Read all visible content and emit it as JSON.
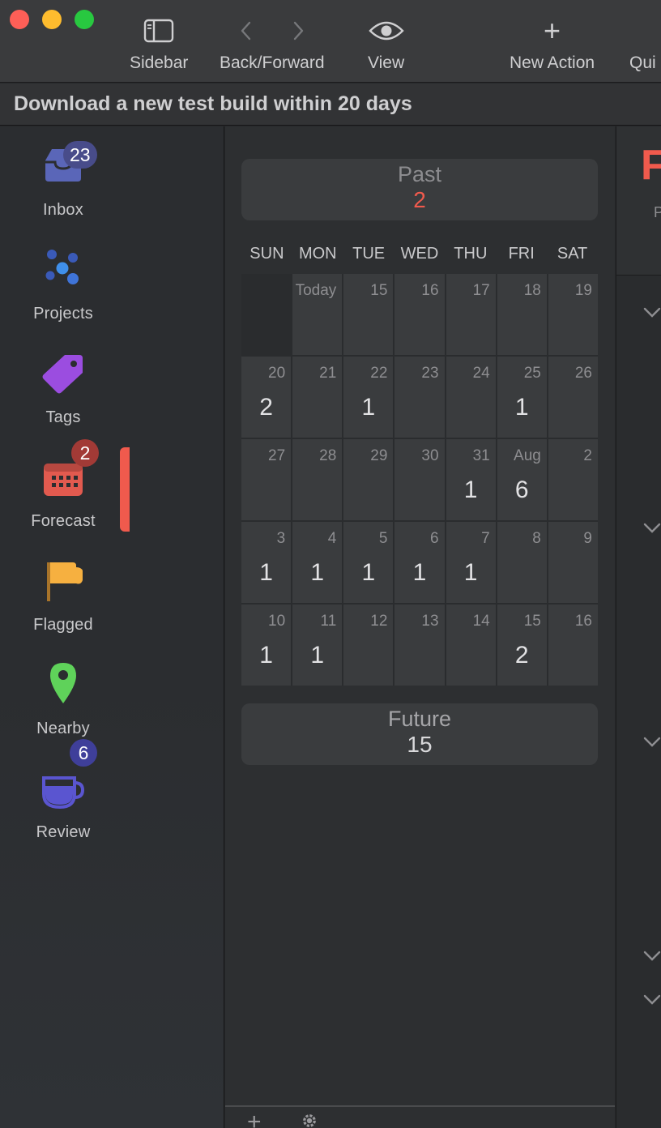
{
  "toolbar": {
    "sidebar_label": "Sidebar",
    "backforward_label": "Back/Forward",
    "view_label": "View",
    "new_action_label": "New Action",
    "quick_label": "Qui",
    "plus_glyph": "+"
  },
  "banner": {
    "text": "Download a new test build within 20 days"
  },
  "sidebar": {
    "items": [
      {
        "label": "Inbox",
        "badge": "23"
      },
      {
        "label": "Projects"
      },
      {
        "label": "Tags"
      },
      {
        "label": "Forecast",
        "badge": "2",
        "selected": true
      },
      {
        "label": "Flagged"
      },
      {
        "label": "Nearby"
      },
      {
        "label": "Review",
        "badge": "6"
      }
    ]
  },
  "forecast": {
    "past": {
      "title": "Past",
      "count": "2"
    },
    "future": {
      "title": "Future",
      "count": "15"
    },
    "weekdays": [
      "SUN",
      "MON",
      "TUE",
      "WED",
      "THU",
      "FRI",
      "SAT"
    ],
    "weeks": [
      [
        {
          "day": "",
          "count": "",
          "empty": true
        },
        {
          "day": "Today",
          "count": ""
        },
        {
          "day": "15",
          "count": ""
        },
        {
          "day": "16",
          "count": ""
        },
        {
          "day": "17",
          "count": ""
        },
        {
          "day": "18",
          "count": ""
        },
        {
          "day": "19",
          "count": ""
        }
      ],
      [
        {
          "day": "20",
          "count": "2"
        },
        {
          "day": "21",
          "count": ""
        },
        {
          "day": "22",
          "count": "1"
        },
        {
          "day": "23",
          "count": ""
        },
        {
          "day": "24",
          "count": ""
        },
        {
          "day": "25",
          "count": "1"
        },
        {
          "day": "26",
          "count": ""
        }
      ],
      [
        {
          "day": "27",
          "count": ""
        },
        {
          "day": "28",
          "count": ""
        },
        {
          "day": "29",
          "count": ""
        },
        {
          "day": "30",
          "count": ""
        },
        {
          "day": "31",
          "count": "1"
        },
        {
          "day": "Aug",
          "count": "6"
        },
        {
          "day": "2",
          "count": ""
        }
      ],
      [
        {
          "day": "3",
          "count": "1"
        },
        {
          "day": "4",
          "count": "1"
        },
        {
          "day": "5",
          "count": "1"
        },
        {
          "day": "6",
          "count": "1"
        },
        {
          "day": "7",
          "count": "1"
        },
        {
          "day": "8",
          "count": ""
        },
        {
          "day": "9",
          "count": ""
        }
      ],
      [
        {
          "day": "10",
          "count": "1"
        },
        {
          "day": "11",
          "count": "1"
        },
        {
          "day": "12",
          "count": ""
        },
        {
          "day": "13",
          "count": ""
        },
        {
          "day": "14",
          "count": ""
        },
        {
          "day": "15",
          "count": "2"
        },
        {
          "day": "16",
          "count": ""
        }
      ]
    ],
    "add_glyph": "+"
  },
  "content": {
    "title_fragment": "F",
    "sub_fragment": "P"
  },
  "colors": {
    "accent": "#f05a4d",
    "inbox": "#5a66b8",
    "projects": "#3f7fe0",
    "tags": "#9b4de0",
    "forecast": "#e25a4f",
    "flagged": "#f6b040",
    "nearby": "#5fd25a",
    "review": "#5a55d0"
  },
  "icons": {
    "sidebar": "sidebar-icon",
    "back": "chevron-left-icon",
    "forward": "chevron-right-icon",
    "view": "eye-icon",
    "new_action": "plus-icon",
    "inbox": "inbox-tray-icon",
    "projects": "projects-dots-icon",
    "tags": "tag-icon",
    "forecast": "calendar-icon",
    "flagged": "flag-icon",
    "nearby": "location-pin-icon",
    "review": "coffee-cup-icon",
    "settings": "gear-icon",
    "disclosure": "chevron-down-icon"
  }
}
